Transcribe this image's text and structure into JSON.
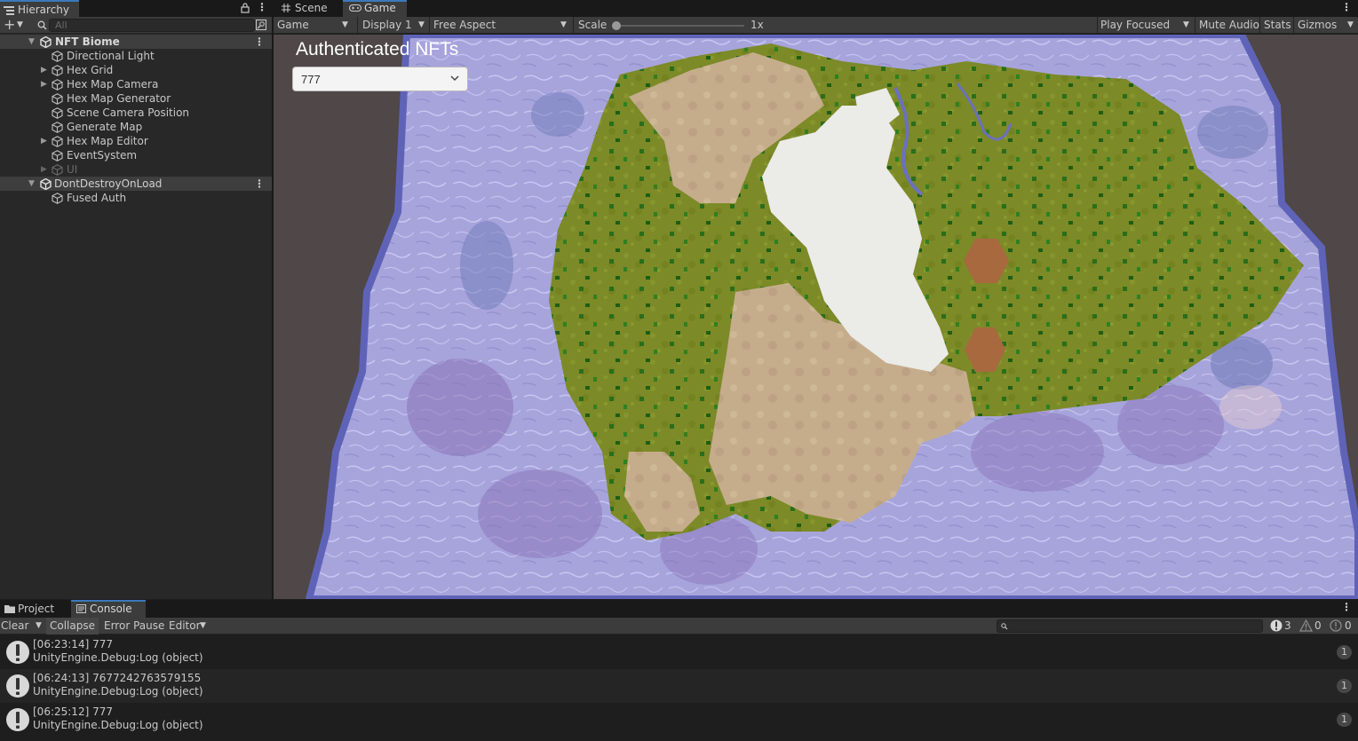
{
  "hierarchy": {
    "tab_label": "Hierarchy",
    "search_placeholder": "All",
    "items": [
      {
        "label": "NFT Biome",
        "type": "scene"
      },
      {
        "label": "Directional Light"
      },
      {
        "label": "Hex Grid",
        "expandable": true
      },
      {
        "label": "Hex Map Camera",
        "expandable": true
      },
      {
        "label": "Hex Map Generator"
      },
      {
        "label": "Scene Camera Position"
      },
      {
        "label": "Generate Map"
      },
      {
        "label": "Hex Map Editor",
        "expandable": true
      },
      {
        "label": "EventSystem"
      },
      {
        "label": "UI",
        "expandable": true,
        "inactive": true
      },
      {
        "label": "DontDestroyOnLoad",
        "type": "scene"
      },
      {
        "label": "Fused Auth"
      }
    ]
  },
  "game_panel": {
    "tabs": [
      {
        "label": "Scene",
        "icon": "grid-icon"
      },
      {
        "label": "Game",
        "icon": "gamepad-icon",
        "active": true
      }
    ],
    "toolbar": {
      "view_mode": "Game",
      "display": "Display 1",
      "aspect": "Free Aspect",
      "scale_label": "Scale",
      "scale_value": "1x",
      "scale_fraction": 0.0,
      "play_focused": "Play Focused",
      "mute_audio": "Mute Audio",
      "stats": "Stats",
      "gizmos": "Gizmos"
    },
    "overlay": {
      "title": "Authenticated NFTs",
      "dropdown_value": "777"
    }
  },
  "bottom_panel": {
    "tabs": [
      {
        "label": "Project",
        "icon": "folder-icon"
      },
      {
        "label": "Console",
        "icon": "console-icon",
        "active": true
      }
    ],
    "toolbar": {
      "clear": "Clear",
      "collapse": "Collapse",
      "error_pause": "Error Pause",
      "editor": "Editor",
      "info_count": "3",
      "warning_count": "0",
      "error_count": "0"
    },
    "logs": [
      {
        "line1": "[06:23:14] 777",
        "line2": "UnityEngine.Debug:Log (object)",
        "count": "1"
      },
      {
        "line1": "[06:24:13] 7677242763579155",
        "line2": "UnityEngine.Debug:Log (object)",
        "count": "1"
      },
      {
        "line1": "[06:25:12] 777",
        "line2": "UnityEngine.Debug:Log (object)",
        "count": "1"
      }
    ]
  },
  "colors": {
    "water": "#a9a6dd",
    "water_deep": "#6b6fb5",
    "grass": "#7f8d28",
    "sand": "#c6ad8b",
    "snow": "#ececea",
    "mud": "#a8693f",
    "tree": "#2f7a1e",
    "accent": "#3a79bb"
  }
}
